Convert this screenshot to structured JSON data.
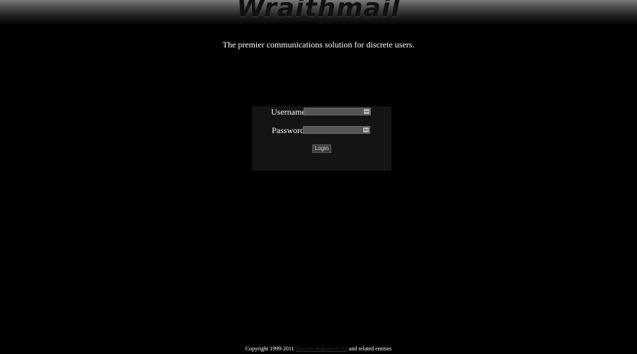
{
  "header": {
    "logo_text": "Wraithmail"
  },
  "tagline": "The premier communications solution for discrete users.",
  "login_form": {
    "username_label": "Username:",
    "username_value": "",
    "username_icon": "key-icon",
    "password_label": "Password:",
    "password_value": "",
    "password_icon": "key-icon",
    "login_button_label": "Login"
  },
  "footer": {
    "copyright_prefix": "Copyright 1999-2011",
    "company_link": "Discrete Industries Ltd",
    "copyright_suffix": "and related entities"
  },
  "colors": {
    "background": "#000000",
    "login_box": "#141414",
    "input_field": "#555555",
    "link": "#2e2e2e"
  }
}
